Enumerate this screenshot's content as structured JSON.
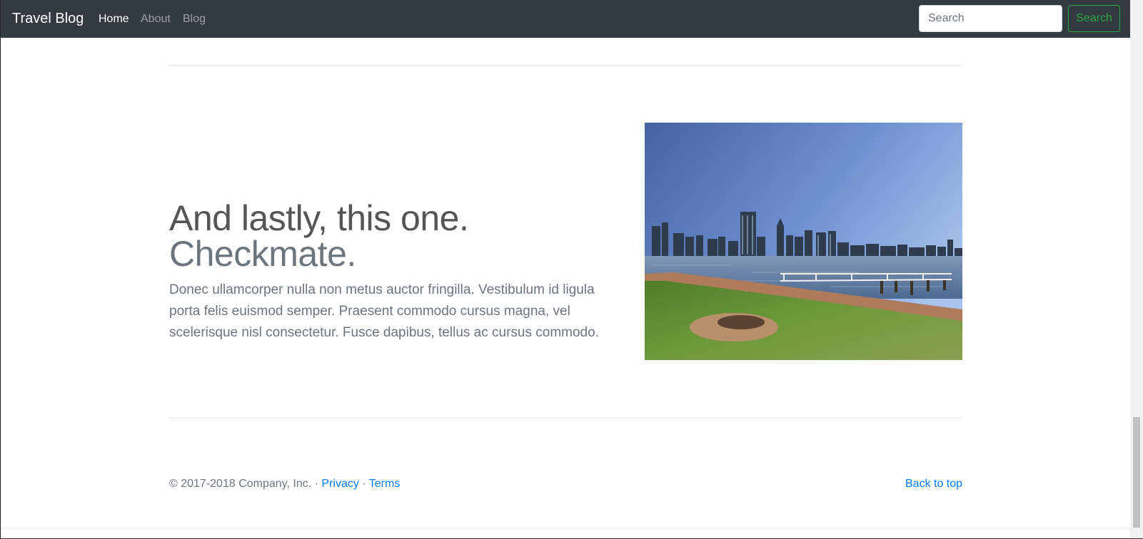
{
  "navbar": {
    "brand": "Travel Blog",
    "links": [
      {
        "label": "Home",
        "active": true
      },
      {
        "label": "About",
        "active": false
      },
      {
        "label": "Blog",
        "active": false
      }
    ],
    "search_placeholder": "Search",
    "search_button": "Search"
  },
  "featurette": {
    "heading": "And lastly, this one.",
    "heading_muted": "Checkmate.",
    "lead": "Donec ullamcorper nulla non metus auctor fringilla. Vestibulum id ligula porta felis euismod semper. Praesent commodo cursus magna, vel scelerisque nisl consectetur. Fusce dapibus, tellus ac cursus commodo."
  },
  "footer": {
    "copyright": "© 2017-2018 Company, Inc. ·",
    "privacy": "Privacy",
    "separator": "·",
    "terms": "Terms",
    "back_to_top": "Back to top"
  },
  "colors": {
    "navbar_bg": "#343a40",
    "link": "#007bff",
    "search_btn": "#28a745",
    "muted": "#6c757d"
  }
}
